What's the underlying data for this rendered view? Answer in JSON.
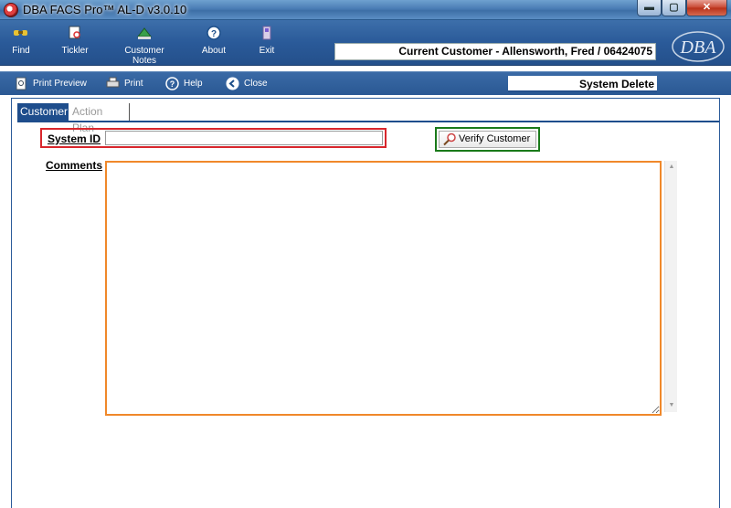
{
  "window": {
    "title": "DBA FACS Pro™ AL-D v3.0.10",
    "min_label": "▬",
    "max_label": "▢",
    "close_label": "✕"
  },
  "toolbar": {
    "find": "Find",
    "tickler": "Tickler",
    "customer_notes": "Customer Notes",
    "about": "About",
    "exit": "Exit",
    "current_customer": "Current Customer - Allensworth, Fred / 06424075",
    "logo_text": "DBA"
  },
  "toolbar2": {
    "print_preview": "Print Preview",
    "print": "Print",
    "help": "Help",
    "close": "Close",
    "mode": "System Delete"
  },
  "tabs": {
    "customer": "Customer",
    "action_plan": "Action Plan"
  },
  "form": {
    "system_id_label": "System ID",
    "system_id_value": "",
    "verify_button": "Verify Customer",
    "comments_label": "Comments",
    "comments_value": ""
  },
  "colors": {
    "toolbar_blue": "#2a5a99",
    "system_id_outline": "#d8262c",
    "verify_outline": "#1a7a1a",
    "comments_outline": "#f0882a"
  }
}
